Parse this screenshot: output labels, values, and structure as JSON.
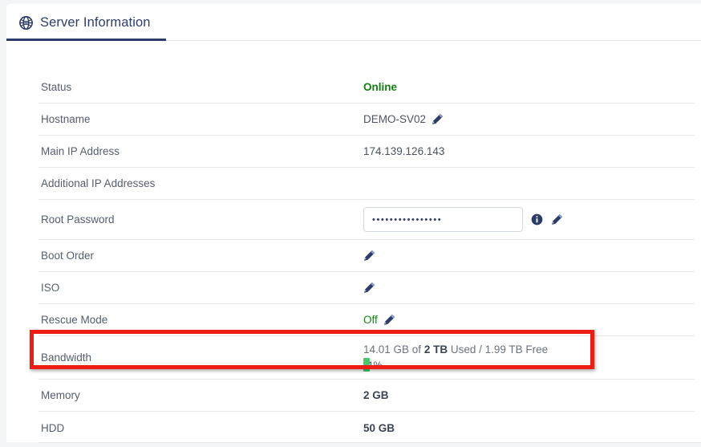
{
  "tab": {
    "label": "Server Information",
    "icon": "globe-icon",
    "active_color": "#2b3c6b"
  },
  "colors": {
    "accent": "#2b3c6b",
    "status_online": "#108010",
    "status_off": "#0f8a0f",
    "highlight": "#ee1c12",
    "progress_fill": "#49c96d"
  },
  "rows": [
    {
      "label": "Status",
      "value": "Online"
    },
    {
      "label": "Hostname",
      "value": "DEMO-SV02"
    },
    {
      "label": "Main IP Address",
      "value": "174.139.126.143"
    },
    {
      "label": "Additional IP Addresses",
      "value": ""
    },
    {
      "label": "Root Password",
      "value": "••••••••••••••••"
    },
    {
      "label": "Boot Order",
      "value": ""
    },
    {
      "label": "ISO",
      "value": ""
    },
    {
      "label": "Rescue Mode",
      "value": "Off"
    },
    {
      "label": "Bandwidth",
      "value": "14.01 GB of 2 TB Used / 1.99 TB Free"
    },
    {
      "label": "Memory",
      "value": "2 GB"
    },
    {
      "label": "HDD",
      "value": "50 GB"
    }
  ],
  "bandwidth": {
    "used_label": "14.01 GB of ",
    "total_bold": "2 TB",
    "used_suffix": " Used / 1.99 TB Free",
    "percent_label": "1%",
    "percent_value": 1
  },
  "root_password": {
    "masked_value": "••••••••••••••••",
    "placeholder": ""
  },
  "icons": {
    "edit": "pencil-icon",
    "info": "info-icon"
  }
}
